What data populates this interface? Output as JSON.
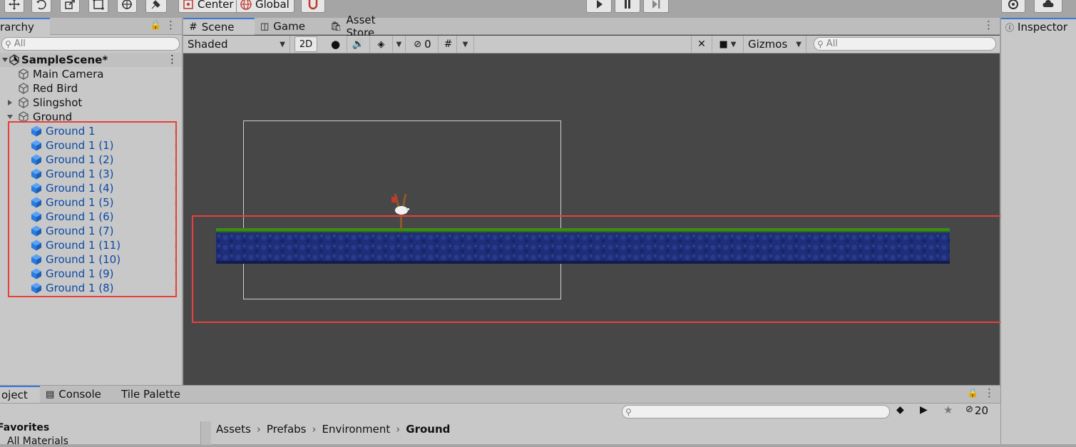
{
  "toolbar": {
    "pivot_label": "Center",
    "space_label": "Global"
  },
  "hierarchy": {
    "tab_label": "rarchy",
    "search_placeholder": "All",
    "scene_name": "SampleScene*",
    "items": [
      {
        "label": "Main Camera"
      },
      {
        "label": "Red Bird"
      },
      {
        "label": "Slingshot"
      },
      {
        "label": "Ground"
      }
    ],
    "ground_children": [
      "Ground 1",
      "Ground 1 (1)",
      "Ground 1 (2)",
      "Ground 1 (3)",
      "Ground 1 (4)",
      "Ground 1 (5)",
      "Ground 1 (6)",
      "Ground 1 (7)",
      "Ground 1 (11)",
      "Ground 1 (10)",
      "Ground 1 (9)",
      "Ground 1 (8)"
    ]
  },
  "scene": {
    "tabs": [
      {
        "label": "Scene"
      },
      {
        "label": "Game"
      },
      {
        "label": "Asset Store"
      }
    ],
    "shading_mode": "Shaded",
    "mode_2d_label": "2D",
    "hidden_count": "0",
    "gizmos_label": "Gizmos",
    "search_placeholder": "All"
  },
  "inspector": {
    "tab_label": "Inspector"
  },
  "bottom": {
    "tabs": [
      {
        "label": "oject"
      },
      {
        "label": "Console"
      },
      {
        "label": "Tile Palette"
      }
    ],
    "hidden_count": "20",
    "favorites_label": "Favorites",
    "favorites_item": "All Materials",
    "breadcrumb": [
      "Assets",
      "Prefabs",
      "Environment",
      "Ground"
    ]
  },
  "colors": {
    "selection_highlight": "#e8403a",
    "prefab_text": "#0b4aa6",
    "prefab_cube": "#2a7be0",
    "viewport_bg": "#474747",
    "ground_top": "#3e8a1a",
    "ground_fill": "#1f2e78"
  },
  "icons": {
    "move": "move-tool-icon",
    "rotate": "rotate-tool-icon",
    "scale": "scale-tool-icon",
    "rect": "rect-tool-icon",
    "transform": "transform-tool-icon",
    "custom": "custom-tool-icon",
    "snap": "snap-icon",
    "play": "play-icon",
    "pause": "pause-icon",
    "step": "step-icon",
    "collab": "collab-icon",
    "cloud": "cloud-icon"
  }
}
